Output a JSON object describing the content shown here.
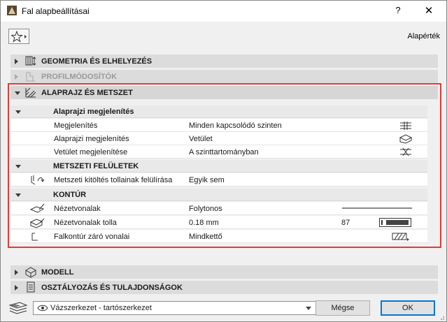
{
  "window": {
    "title": "Fal alapbeállításai",
    "help_label": "?",
    "close_label": "✕",
    "default_label": "Alapérték"
  },
  "sections": {
    "geometry": {
      "label": "GEOMETRIA ÉS ELHELYEZÉS",
      "icon": "geometry-icon",
      "expanded": false
    },
    "profile": {
      "label": "PROFILMÓDOSÍTÓK",
      "icon": "profile-icon",
      "expanded": false,
      "disabled": true
    },
    "floorplan": {
      "label": "ALAPRAJZ ÉS METSZET",
      "icon": "floorplan-section-icon",
      "expanded": true
    },
    "model": {
      "label": "MODELL",
      "icon": "model-icon",
      "expanded": false
    },
    "classification": {
      "label": "OSZTÁLYOZÁS ÉS TULAJDONSÁGOK",
      "icon": "classification-icon",
      "expanded": false
    }
  },
  "groups": {
    "floorplan_display": {
      "label": "Alaprajzi megjelenítés"
    },
    "cut_surfaces": {
      "label": "METSZETI FELÜLETEK"
    },
    "outlines": {
      "label": "KONTÚR"
    }
  },
  "rows": {
    "show_on_stories": {
      "label": "Megjelenítés",
      "value": "Minden kapcsolódó szinten"
    },
    "floorplan_display": {
      "label": "Alaprajzi megjelenítés",
      "value": "Vetület"
    },
    "show_projection": {
      "label": "Vetület megjelenítése",
      "value": "A szinttartományban"
    },
    "cut_fill_pens": {
      "label": "Metszeti kitöltés tollainak felülírása",
      "value": "Egyik sem"
    },
    "uncut_lines": {
      "label": "Nézetvonalak",
      "value": "Folytonos"
    },
    "uncut_line_pen": {
      "label": "Nézetvonalak tolla",
      "value": "0.18 mm",
      "pen_number": "87"
    },
    "outline_closing": {
      "label": "Falkontúr záró vonalai",
      "value": "Mindkettő"
    }
  },
  "bottom": {
    "layer_value": "Vázszerkezet - tartószerkezet",
    "cancel_label": "Mégse",
    "ok_label": "OK"
  },
  "colors": {
    "highlight": "#e23a3a",
    "ok_border": "#0078d7"
  }
}
